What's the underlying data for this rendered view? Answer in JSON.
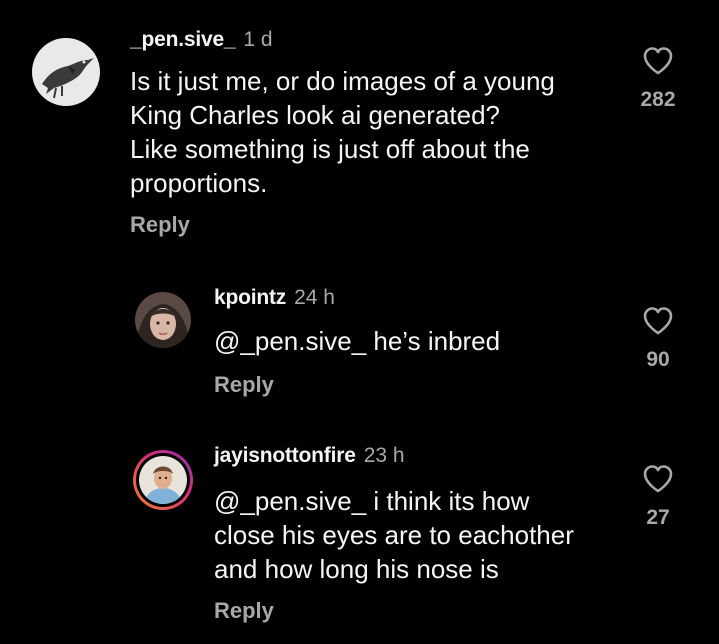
{
  "comments": [
    {
      "username": "_pen.sive_",
      "time": "1 d",
      "text": "Is it just me, or do images of a young\nKing Charles look ai generated?\nLike something is just off about the\nproportions.",
      "reply_label": "Reply",
      "likes": "282"
    },
    {
      "username": "kpointz",
      "time": "24 h",
      "text": "@_pen.sive_ he’s inbred",
      "reply_label": "Reply",
      "likes": "90"
    },
    {
      "username": "jayisnottonfire",
      "time": "23 h",
      "text": "@_pen.sive_ i think its how\nclose his eyes are to eachother\nand how long his nose is",
      "reply_label": "Reply",
      "likes": "27"
    }
  ],
  "colors": {
    "background": "#000000",
    "primary_text": "#f5f5f5",
    "secondary_text": "#a8a8a8",
    "story_ring_start": "#f58529",
    "story_ring_end": "#dd2a7b"
  },
  "icons": {
    "like": "heart-outline-icon"
  }
}
